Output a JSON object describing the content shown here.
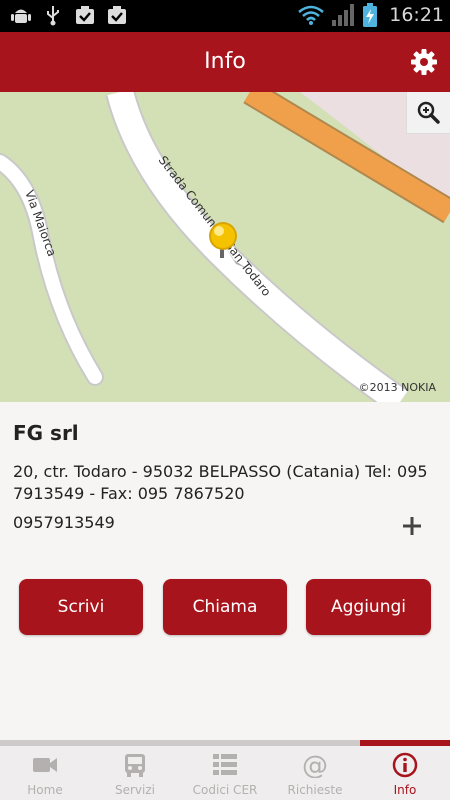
{
  "status_bar": {
    "time": "16:21",
    "icons": [
      "android-debug-icon",
      "usb-icon",
      "download-done-icon",
      "download-done-icon",
      "wifi-icon",
      "signal-icon",
      "battery-charging-icon"
    ]
  },
  "app_bar": {
    "title": "Info",
    "settings_icon": "gear-icon"
  },
  "map": {
    "road_labels": [
      "Strada Comunale San Todaro",
      "Via Maiorca"
    ],
    "copyright": "©2013 NOKIA",
    "zoom_icon": "zoom-in-icon"
  },
  "contact": {
    "company": "FG srl",
    "address": "20, ctr. Todaro - 95032 BELPASSO (Catania) Tel: 095 7913549 - Fax: 095 7867520",
    "phone": "0957913549",
    "add_icon": "plus-icon"
  },
  "actions": {
    "write": "Scrivi",
    "call": "Chiama",
    "add": "Aggiungi"
  },
  "tabs": [
    {
      "label": "Home",
      "icon": "video-camera-icon",
      "active": false
    },
    {
      "label": "Servizi",
      "icon": "truck-icon",
      "active": false
    },
    {
      "label": "Codici CER",
      "icon": "list-icon",
      "active": false
    },
    {
      "label": "Richieste",
      "icon": "at-icon",
      "active": false
    },
    {
      "label": "Info",
      "icon": "info-icon",
      "active": true
    }
  ],
  "colors": {
    "accent": "#a8141c",
    "map_green": "#d3e0b6",
    "highway": "#f0a04a",
    "inactive_tab": "#b4b0b0"
  }
}
